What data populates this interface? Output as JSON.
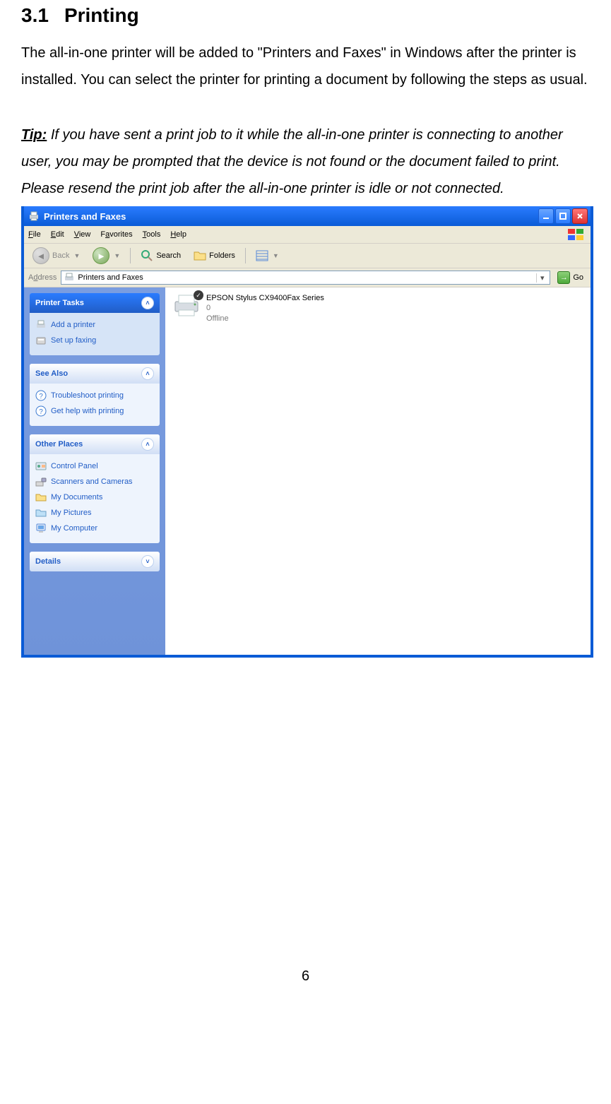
{
  "section": {
    "number": "3.1",
    "title": "Printing"
  },
  "paragraph": "The all-in-one printer will be added to \"Printers and Faxes\" in Windows after the printer is installed. You can select the printer for printing a document by following the steps as usual.",
  "tip": {
    "label": "Tip:",
    "text": " If you have sent a print job to it while the all-in-one printer is connecting to another user, you may be prompted that the device is not found or the document failed to print. Please resend the print job after the all-in-one printer is idle or not connected."
  },
  "page_number": "6",
  "window": {
    "title": "Printers and Faxes",
    "menu": {
      "file": "File",
      "edit": "Edit",
      "view": "View",
      "favorites": "Favorites",
      "tools": "Tools",
      "help": "Help"
    },
    "toolbar": {
      "back": "Back",
      "search": "Search",
      "folders": "Folders"
    },
    "addressbar": {
      "label": "Address",
      "value": "Printers and Faxes",
      "go": "Go"
    },
    "taskpane": {
      "printer_tasks": {
        "header": "Printer Tasks",
        "add": "Add a printer",
        "fax": "Set up faxing"
      },
      "see_also": {
        "header": "See Also",
        "troubleshoot": "Troubleshoot printing",
        "help": "Get help with printing"
      },
      "other_places": {
        "header": "Other Places",
        "cp": "Control Panel",
        "sc": "Scanners and Cameras",
        "md": "My Documents",
        "mp": "My Pictures",
        "mc": "My Computer"
      },
      "details": {
        "header": "Details"
      }
    },
    "content": {
      "printer_name": "EPSON Stylus CX9400Fax Series",
      "queue": "0",
      "status": "Offline"
    }
  }
}
